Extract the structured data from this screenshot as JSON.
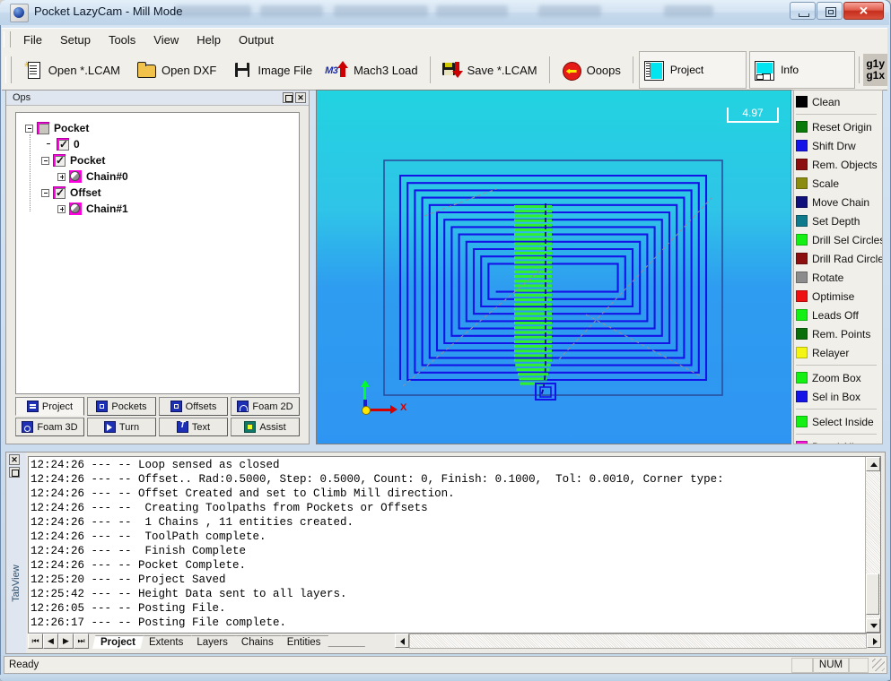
{
  "window": {
    "title": "Pocket LazyCam - Mill Mode",
    "icon": "app-globe-icon",
    "minimize_label": "",
    "maximize_label": "",
    "close_label": "✕"
  },
  "menu": {
    "items": [
      {
        "label": "File"
      },
      {
        "label": "Setup"
      },
      {
        "label": "Tools"
      },
      {
        "label": "View"
      },
      {
        "label": "Help"
      },
      {
        "label": "Output"
      }
    ]
  },
  "toolbar": {
    "buttons": [
      {
        "label": "Open *.LCAM",
        "icon": "new-document-icon"
      },
      {
        "label": "Open DXF",
        "icon": "open-folder-icon"
      },
      {
        "label": "Image File",
        "icon": "floppy-disk-icon"
      },
      {
        "label": "Mach3 Load",
        "icon": "mach3-load-icon"
      },
      {
        "label": "Save *.LCAM",
        "icon": "save-disk-down-icon"
      },
      {
        "label": "Ooops",
        "icon": "undo-arrow-icon"
      }
    ],
    "panels": [
      {
        "label": "Project",
        "icon": "project-view-icon"
      },
      {
        "label": "Info",
        "icon": "info-view-icon"
      }
    ],
    "g1_labels": {
      "top": "g1y",
      "bottom": "g1x"
    }
  },
  "ops_panel": {
    "title": "Ops",
    "restore_label": "",
    "close_label": "✕",
    "tree": [
      {
        "label": "Pocket",
        "indent": 0,
        "toggle": "minus",
        "marker": "checkbox-grey",
        "checked": false
      },
      {
        "label": "0",
        "indent": 1,
        "toggle": "none",
        "marker": "checkbox",
        "checked": true
      },
      {
        "label": "Pocket",
        "indent": 1,
        "toggle": "minus",
        "marker": "checkbox",
        "checked": true
      },
      {
        "label": "Chain#0",
        "indent": 2,
        "toggle": "plus",
        "marker": "circle",
        "checked": false
      },
      {
        "label": "Offset",
        "indent": 1,
        "toggle": "minus",
        "marker": "checkbox",
        "checked": true
      },
      {
        "label": "Chain#1",
        "indent": 2,
        "toggle": "plus",
        "marker": "circle",
        "checked": false
      }
    ],
    "tabs_row1": [
      {
        "label": "Project",
        "icon": "project-tab-icon",
        "active": true
      },
      {
        "label": "Pockets",
        "icon": "pockets-tab-icon",
        "active": false
      },
      {
        "label": "Offsets",
        "icon": "offsets-tab-icon",
        "active": false
      },
      {
        "label": "Foam 2D",
        "icon": "foam2d-tab-icon",
        "active": false
      }
    ],
    "tabs_row2": [
      {
        "label": "Foam 3D",
        "icon": "foam3d-tab-icon",
        "active": false
      },
      {
        "label": "Turn",
        "icon": "turn-tab-icon",
        "active": false
      },
      {
        "label": "Text",
        "icon": "text-tab-icon",
        "active": false
      },
      {
        "label": "Assist",
        "icon": "assist-tab-icon",
        "active": false
      }
    ]
  },
  "canvas": {
    "scale_value": "4.97",
    "axis_x_label": "X",
    "background_top": "#22d3e0",
    "background_bottom": "#2f95f2",
    "toolpath_color": "#1414e6",
    "outline_color": "#2b3f9e",
    "slot_color": "#2ef02e",
    "rapid_color": "#8b8b9b"
  },
  "sidebar": {
    "items": [
      {
        "label": "Clean",
        "color": "#000000"
      },
      {
        "sep": true
      },
      {
        "label": "Reset Origin",
        "color": "#0a7a0a"
      },
      {
        "label": "Shift Drw",
        "color": "#1414e6"
      },
      {
        "label": "Rem. Objects",
        "color": "#8b0f0f"
      },
      {
        "label": "Scale",
        "color": "#8b8b0f"
      },
      {
        "label": "Move Chain",
        "color": "#10107a"
      },
      {
        "label": "Set Depth",
        "color": "#0f7a8b"
      },
      {
        "label": "Drill Sel Circles",
        "color": "#14f014"
      },
      {
        "label": "Drill Rad Circles",
        "color": "#8b0f0f"
      },
      {
        "label": "Rotate",
        "color": "#8c8c8c"
      },
      {
        "label": "Optimise",
        "color": "#ee1111"
      },
      {
        "label": "Leads Off",
        "color": "#14f014"
      },
      {
        "label": "Rem. Points",
        "color": "#0a6e0a"
      },
      {
        "label": "Relayer",
        "color": "#f5f514"
      },
      {
        "sep": true
      },
      {
        "label": "Zoom Box",
        "color": "#14f014"
      },
      {
        "label": "Sel in Box",
        "color": "#1414e6"
      },
      {
        "sep": true
      },
      {
        "label": "Select Inside",
        "color": "#14f014"
      },
      {
        "sep": true
      },
      {
        "label": "Desel All",
        "color": "#f514d8"
      }
    ]
  },
  "log": {
    "tabview_label": "TabView",
    "close_label": "✕",
    "restore_label": "",
    "lines": [
      "12:24:26 --- -- Loop sensed as closed",
      "12:24:26 --- -- Offset.. Rad:0.5000, Step: 0.5000, Count: 0, Finish: 0.1000,  Tol: 0.0010, Corner type:",
      "12:24:26 --- -- Offset Created and set to Climb Mill direction.",
      "12:24:26 --- --  Creating Toolpaths from Pockets or Offsets",
      "12:24:26 --- --  1 Chains , 11 entities created.",
      "12:24:26 --- --  ToolPath complete.",
      "12:24:26 --- --  Finish Complete",
      "12:24:26 --- -- Pocket Complete.",
      "12:25:20 --- -- Project Saved",
      "12:25:42 --- -- Height Data sent to all layers.",
      "12:26:05 --- -- Posting File.",
      "12:26:17 --- -- Posting File complete."
    ]
  },
  "bottom_tabs": {
    "nav": [
      {
        "label": "⏮",
        "name": "first-record-button"
      },
      {
        "label": "◀",
        "name": "prev-record-button"
      },
      {
        "label": "▶",
        "name": "next-record-button"
      },
      {
        "label": "⏭",
        "name": "last-record-button"
      }
    ],
    "tabs": [
      {
        "label": "Project",
        "active": true
      },
      {
        "label": "Extents",
        "active": false
      },
      {
        "label": "Layers",
        "active": false
      },
      {
        "label": "Chains",
        "active": false
      },
      {
        "label": "Entities",
        "active": false
      }
    ]
  },
  "statusbar": {
    "message": "Ready",
    "num_indicator": "NUM"
  }
}
